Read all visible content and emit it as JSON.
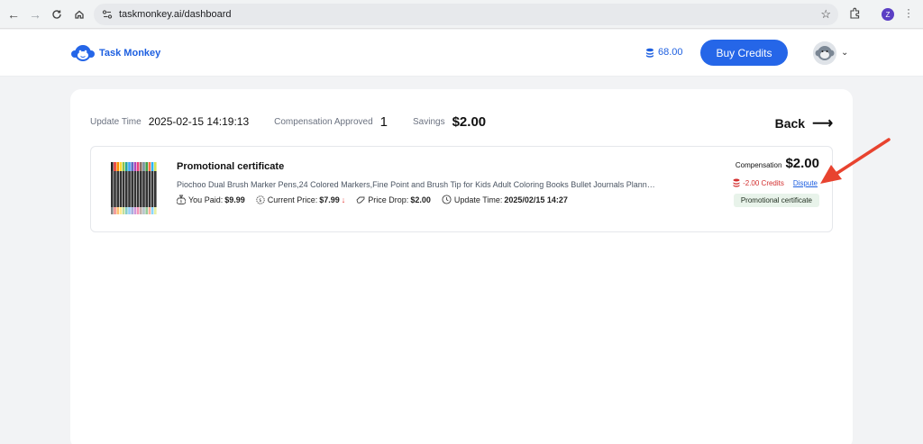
{
  "browser": {
    "url": "taskmonkey.ai/dashboard",
    "profile_initial": "Z"
  },
  "header": {
    "brand": "Task Monkey",
    "credits": "68.00",
    "buy_label": "Buy Credits"
  },
  "summary": {
    "update_time_label": "Update Time",
    "update_time_value": "2025-02-15 14:19:13",
    "approved_label": "Compensation Approved",
    "approved_value": "1",
    "savings_label": "Savings",
    "savings_value": "$2.00",
    "back_label": "Back"
  },
  "item": {
    "title": "Promotional certificate",
    "description": "Piochoo Dual Brush Marker Pens,24 Colored Markers,Fine Point and Brush Tip for Kids Adult Coloring Books Bullet Journals Plann…",
    "you_paid_label": "You Paid:",
    "you_paid_value": "$9.99",
    "current_price_label": "Current Price:",
    "current_price_value": "$7.99",
    "price_drop_label": "Price Drop:",
    "price_drop_value": "$2.00",
    "update_time_label": "Update Time:",
    "update_time_value": "2025/02/15 14:27",
    "compensation_label": "Compensation",
    "compensation_value": "$2.00",
    "credits_change": "-2.00 Credits",
    "dispute_label": "Dispute",
    "badge": "Promotional certificate"
  },
  "colors": {
    "brand_blue": "#2566e8",
    "annotation_red": "#e8432f",
    "negative_red": "#d32f2f"
  }
}
